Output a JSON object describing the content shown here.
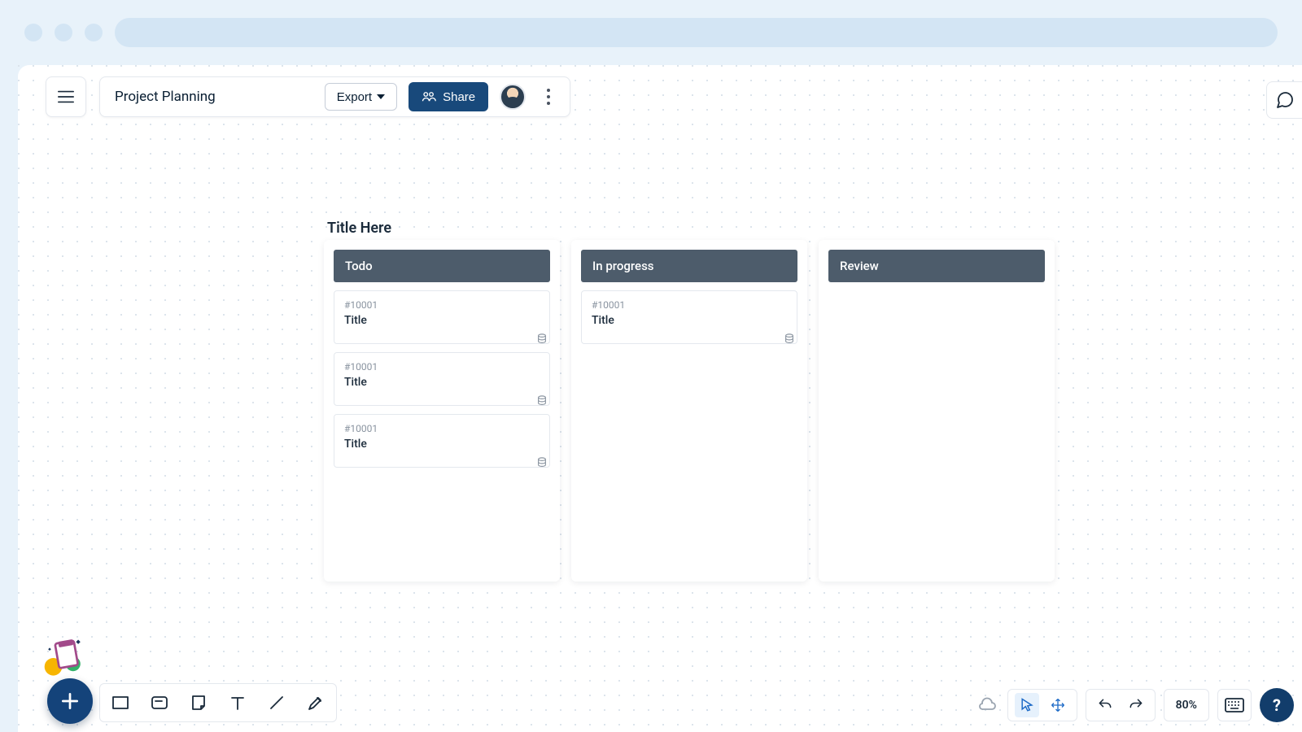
{
  "topbar": {
    "title": "Project Planning",
    "export_label": "Export",
    "share_label": "Share"
  },
  "board": {
    "title": "Title Here",
    "columns": [
      {
        "header": "Todo",
        "cards": [
          {
            "id": "#10001",
            "title": "Title"
          },
          {
            "id": "#10001",
            "title": "Title"
          },
          {
            "id": "#10001",
            "title": "Title"
          }
        ]
      },
      {
        "header": "In progress",
        "cards": [
          {
            "id": "#10001",
            "title": "Title"
          }
        ]
      },
      {
        "header": "Review",
        "cards": []
      }
    ]
  },
  "footer": {
    "zoom": "80%",
    "help": "?"
  }
}
